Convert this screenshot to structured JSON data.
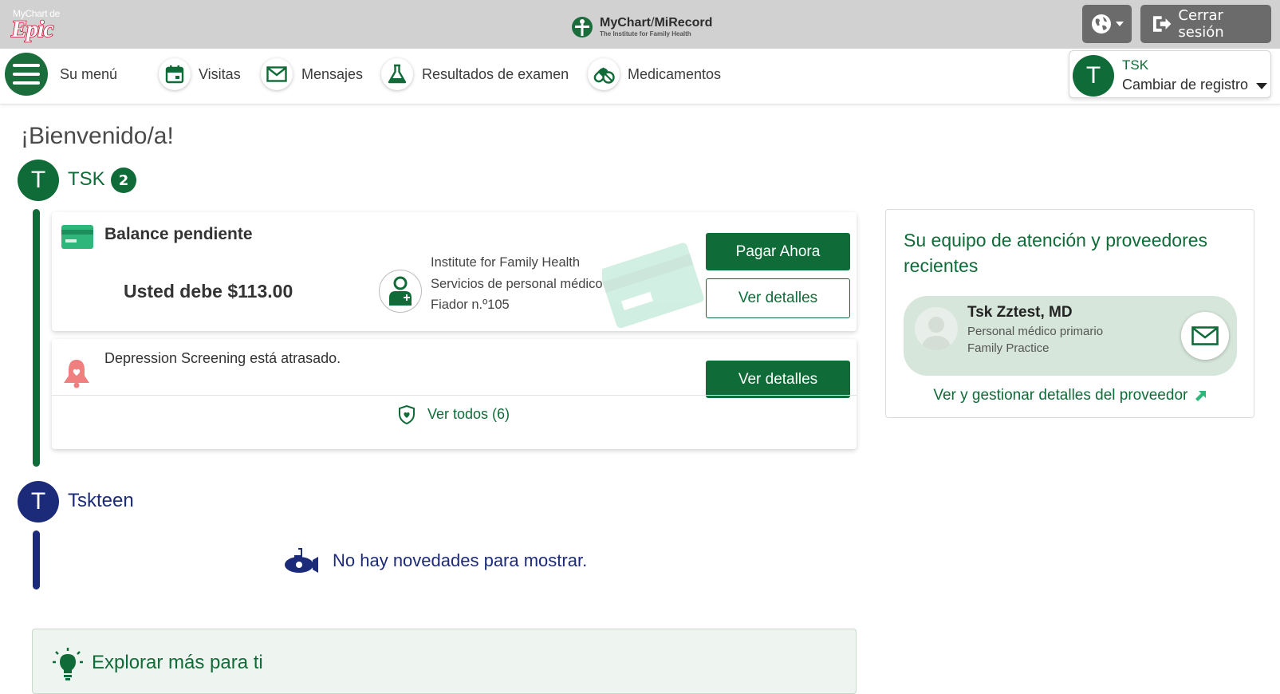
{
  "header": {
    "epic_small": "MyChart de",
    "epic_big": "Epic",
    "brand_title_left": "MyChart",
    "brand_title_sep": "/",
    "brand_title_right": "MiRecord",
    "brand_subtitle": "The Institute for Family Health",
    "logout_label": "Cerrar sesión"
  },
  "nav": {
    "menu_label": "Su menú",
    "items": [
      {
        "label": "Visitas",
        "icon": "calendar-icon"
      },
      {
        "label": "Mensajes",
        "icon": "envelope-icon"
      },
      {
        "label": "Resultados de examen",
        "icon": "flask-icon"
      },
      {
        "label": "Medicamentos",
        "icon": "pills-icon"
      }
    ],
    "switcher": {
      "initial": "T",
      "name": "TSK",
      "action": "Cambiar de registro"
    }
  },
  "main": {
    "welcome": "¡Bienvenido/a!",
    "person1": {
      "initial": "T",
      "name": "TSK",
      "badge": "2"
    },
    "balance": {
      "title": "Balance pendiente",
      "amount_text": "Usted debe $113.00",
      "payee_lines": [
        "Institute for Family Health",
        "Servicios de personal médico",
        "Fiador n.º105"
      ],
      "pay_button": "Pagar Ahora",
      "details_button": "Ver detalles"
    },
    "alert": {
      "text": "Depression Screening está atrasado.",
      "details_button": "Ver detalles",
      "view_all": "Ver todos (6)"
    },
    "person2": {
      "initial": "T",
      "name": "Tskteen"
    },
    "no_news": "No hay novedades para mostrar.",
    "explore_title": "Explorar más para ti"
  },
  "team": {
    "title": "Su equipo de atención y proveedores recientes",
    "provider_name": "Tsk Zztest, MD",
    "provider_role": "Personal médico primario",
    "provider_dept": "Family Practice",
    "provider_link": "Ver y gestionar detalles del proveedor"
  },
  "colors": {
    "brand_green": "#0f6b37",
    "navy": "#1c2a7a",
    "topbar_gray": "#d1d1d1",
    "button_gray": "#6b6b6b"
  }
}
